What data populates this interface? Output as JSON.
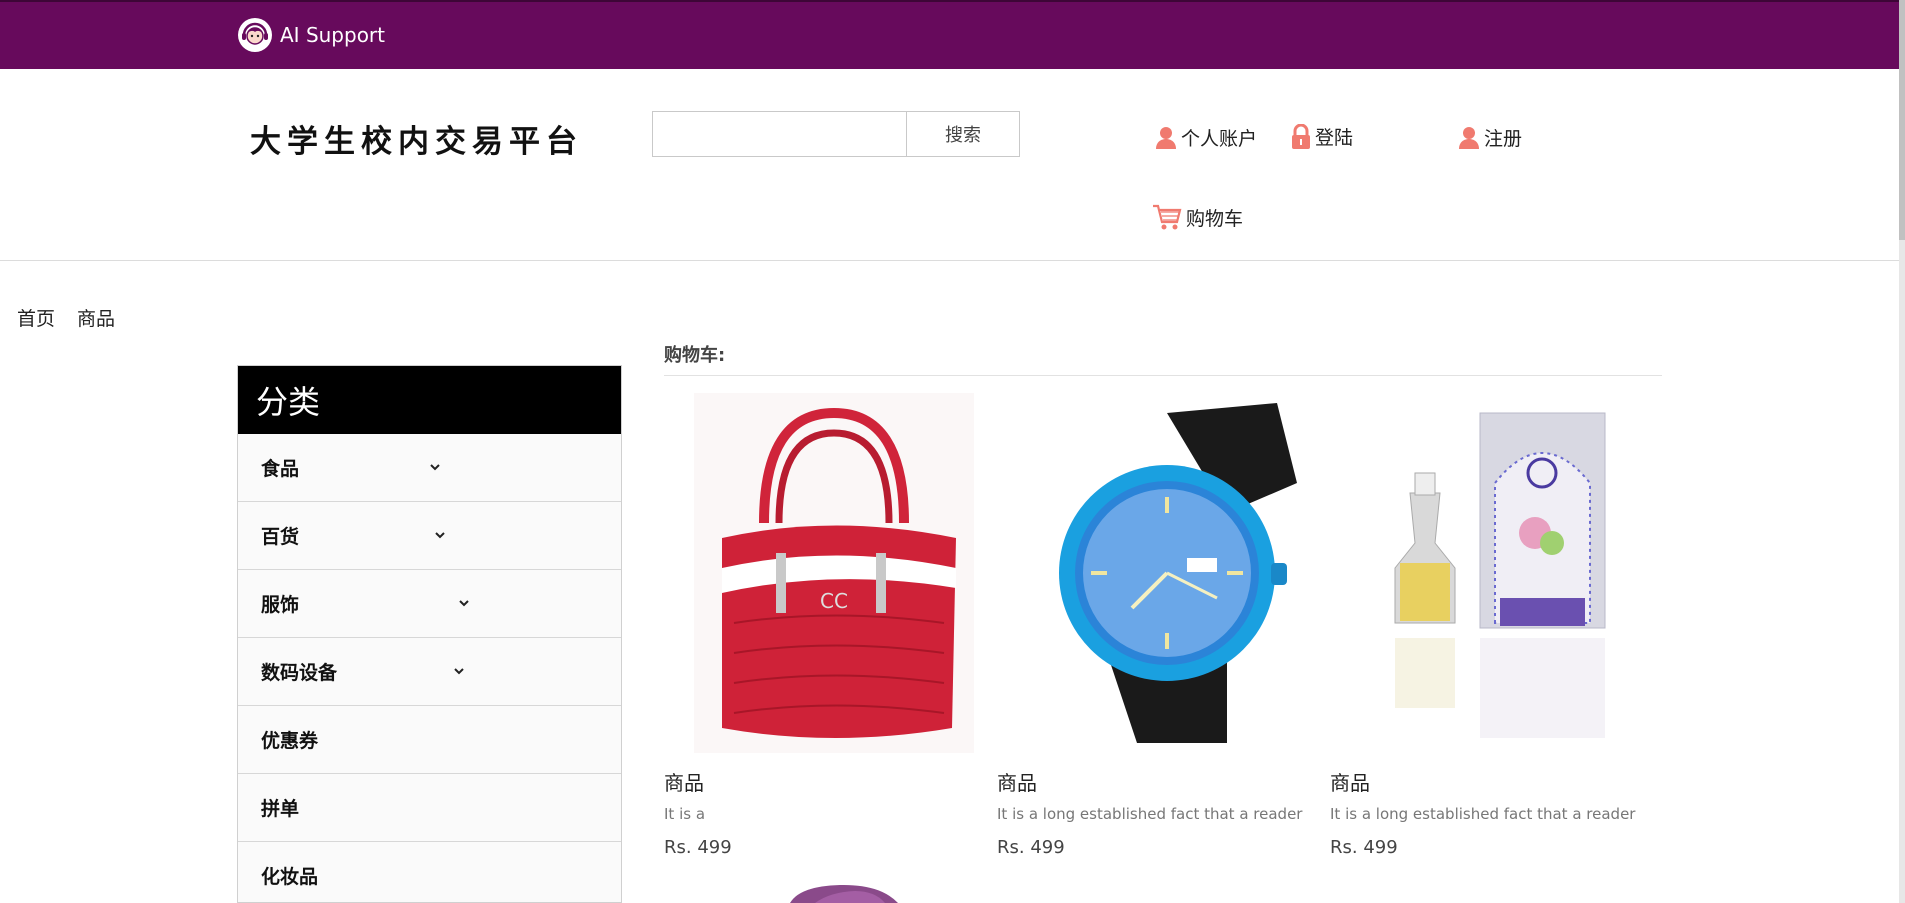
{
  "topbar": {
    "support_label": "AI Support"
  },
  "header": {
    "brand": "大学生校内交易平台",
    "search": {
      "placeholder": "",
      "button": "搜索"
    },
    "links": {
      "account": "个人账户",
      "login": "登陆",
      "register": "注册",
      "cart": "购物车"
    }
  },
  "breadcrumb": {
    "home": "首页",
    "current": "商品"
  },
  "sidebar": {
    "title": "分类",
    "items": [
      {
        "label": "食品",
        "expandable": true
      },
      {
        "label": "百货",
        "expandable": true
      },
      {
        "label": "服饰",
        "expandable": true
      },
      {
        "label": "数码设备",
        "expandable": true
      },
      {
        "label": "优惠券",
        "expandable": false
      },
      {
        "label": "拼单",
        "expandable": false
      },
      {
        "label": "化妆品",
        "expandable": false
      }
    ]
  },
  "main": {
    "cart_label": "购物车:",
    "products": [
      {
        "name": "商品",
        "desc": "It is a",
        "price": "Rs. 499",
        "image": "red-handbag"
      },
      {
        "name": "商品",
        "desc": "It is a long established fact that a reader",
        "price": "Rs. 499",
        "image": "blue-watch"
      },
      {
        "name": "商品",
        "desc": "It is a long established fact that a reader",
        "price": "Rs. 499",
        "image": "perfume-box"
      }
    ]
  },
  "colors": {
    "topbar": "#670a5c",
    "icon_accent": "#f07a6f",
    "sidebar_header": "#000000"
  },
  "icons": [
    "support-avatar-icon",
    "user-icon",
    "lock-icon",
    "cart-icon",
    "chevron-down-icon"
  ]
}
